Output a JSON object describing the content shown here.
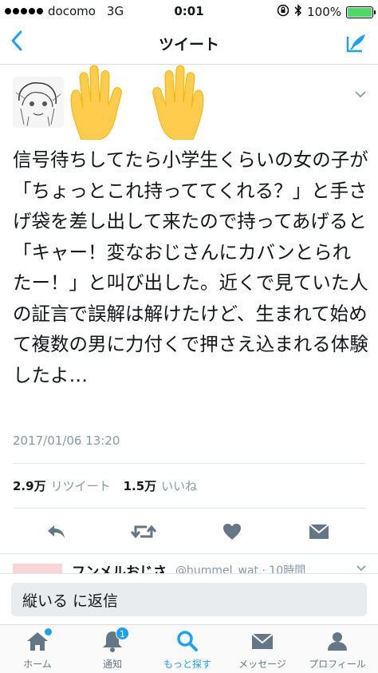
{
  "status_bar": {
    "carrier": "docomo",
    "network": "3G",
    "time": "0:01",
    "battery": "100%",
    "battery_color": "#4cd964"
  },
  "nav": {
    "title": "ツイート",
    "back_icon": "chevron-left-icon",
    "compose_icon": "compose-tweet-icon",
    "accent_color": "#1da1f2"
  },
  "tweet": {
    "text": "信号待ちしてたら小学生くらいの女の子が「ちょっとこれ持っててくれる？」と手さげ袋を差し出して来たので持ってあげると「キャー！変なおじさんにカバンとられたー！」と叫び出した。近くで見ていた人の証言で誤解は解けたけど、生まれて始めて複数の男に力付くで押さえ込まれる体験したよ…",
    "timestamp": "2017/01/06 13:20",
    "retweets_count": "2.9万",
    "retweets_label": "リツイート",
    "likes_count": "1.5万",
    "likes_label": "いいね"
  },
  "next_tweet": {
    "name": "フンメルおじさ",
    "handle": "@hummel_wat · 10時間"
  },
  "reply": {
    "placeholder": "縦いる に返信"
  },
  "tabbar": {
    "tabs": [
      {
        "label": "ホーム",
        "icon": "home-icon"
      },
      {
        "label": "通知",
        "icon": "bell-icon",
        "badge": "1"
      },
      {
        "label": "もっと探す",
        "icon": "search-icon"
      },
      {
        "label": "メッセージ",
        "icon": "envelope-icon"
      },
      {
        "label": "プロフィール",
        "icon": "profile-icon"
      }
    ]
  }
}
